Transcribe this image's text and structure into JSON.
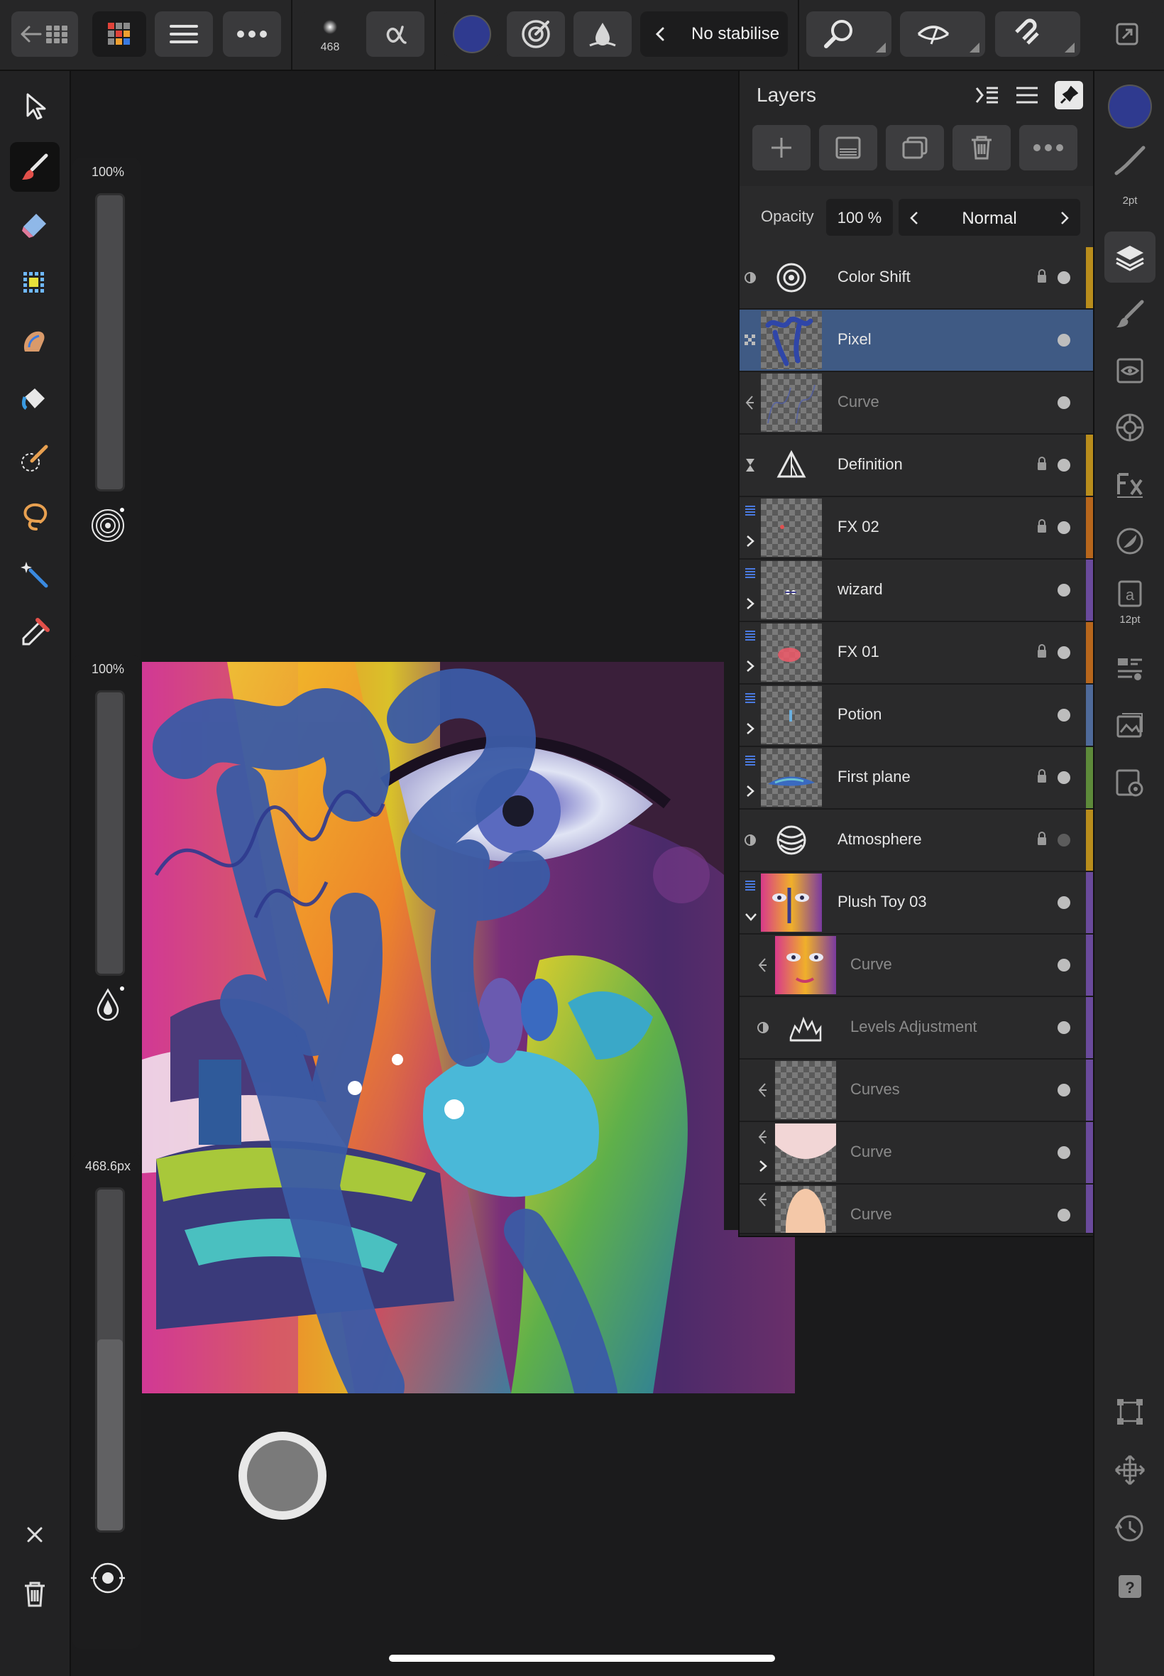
{
  "toolbar": {
    "brush_size_readout": "468",
    "stabiliser_label": "No stabilise",
    "color_hex": "#2f3a8f"
  },
  "sliders": {
    "opacity_label": "100%",
    "flow_label": "100%",
    "size_label": "468.6px",
    "size_fraction": 0.56
  },
  "layers": {
    "title": "Layers",
    "opacity_label": "Opacity",
    "opacity_value": "100 %",
    "blend_mode": "Normal",
    "rows": [
      {
        "name": "Color Shift",
        "tag": "#b98d1c"
      },
      {
        "name": "Pixel",
        "tag": "#3f5a84",
        "selected": true
      },
      {
        "name": "Curve",
        "tag": ""
      },
      {
        "name": "Definition",
        "tag": "#b98d1c"
      },
      {
        "name": "FX 02",
        "tag": "#b7661c"
      },
      {
        "name": "wizard",
        "tag": "#6a4a9c"
      },
      {
        "name": "FX 01",
        "tag": "#b7661c"
      },
      {
        "name": "Potion",
        "tag": "#4f6a9a"
      },
      {
        "name": "First plane",
        "tag": "#5d8a3a"
      },
      {
        "name": "Atmosphere",
        "tag": "#b98d1c"
      },
      {
        "name": "Plush Toy 03",
        "tag": "#6a4a9c"
      },
      {
        "name": "Curve",
        "tag": "#6a4a9c"
      },
      {
        "name": "Levels Adjustment",
        "tag": "#6a4a9c"
      },
      {
        "name": "Curves",
        "tag": "#6a4a9c"
      },
      {
        "name": "Curve",
        "tag": "#6a4a9c"
      },
      {
        "name": "Curve",
        "tag": "#6a4a9c"
      }
    ]
  },
  "studio": {
    "brush_width_label": "2pt",
    "text_size_label": "12pt"
  }
}
